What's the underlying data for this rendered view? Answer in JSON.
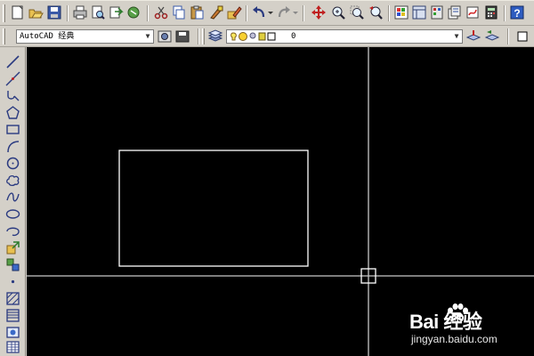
{
  "app": "AutoCAD",
  "workspace_combo": {
    "value": "AutoCAD 经典"
  },
  "layer_combo": {
    "value": "0"
  },
  "standard_toolbar": {
    "icons": [
      "new-icon",
      "open-icon",
      "save-icon",
      "print-icon",
      "print-preview-icon",
      "publish-icon",
      "3d-dwf-icon",
      "cut-icon",
      "copy-icon",
      "paste-icon",
      "match-properties-icon",
      "block-editor-icon",
      "undo-icon",
      "redo-icon",
      "pan-icon",
      "zoom-realtime-icon",
      "zoom-window-icon",
      "zoom-previous-icon",
      "properties-icon",
      "design-center-icon",
      "tool-palettes-icon",
      "sheet-set-icon",
      "markup-icon",
      "calculator-icon",
      "help-icon"
    ]
  },
  "draw_toolbar": {
    "icons": [
      "line-icon",
      "construction-line-icon",
      "polyline-icon",
      "polygon-icon",
      "rectangle-icon",
      "arc-icon",
      "circle-icon",
      "revision-cloud-icon",
      "spline-icon",
      "ellipse-icon",
      "ellipse-arc-icon",
      "insert-block-icon",
      "make-block-icon",
      "point-icon",
      "hatch-icon",
      "gradient-icon",
      "region-icon",
      "table-icon"
    ]
  },
  "canvas": {
    "background": "#000000",
    "rectangle_color": "#ffffff",
    "crosshair_color": "#c8c8c8"
  },
  "watermark": {
    "brand": "Bai  经验",
    "url": "jingyan.baidu.com"
  }
}
